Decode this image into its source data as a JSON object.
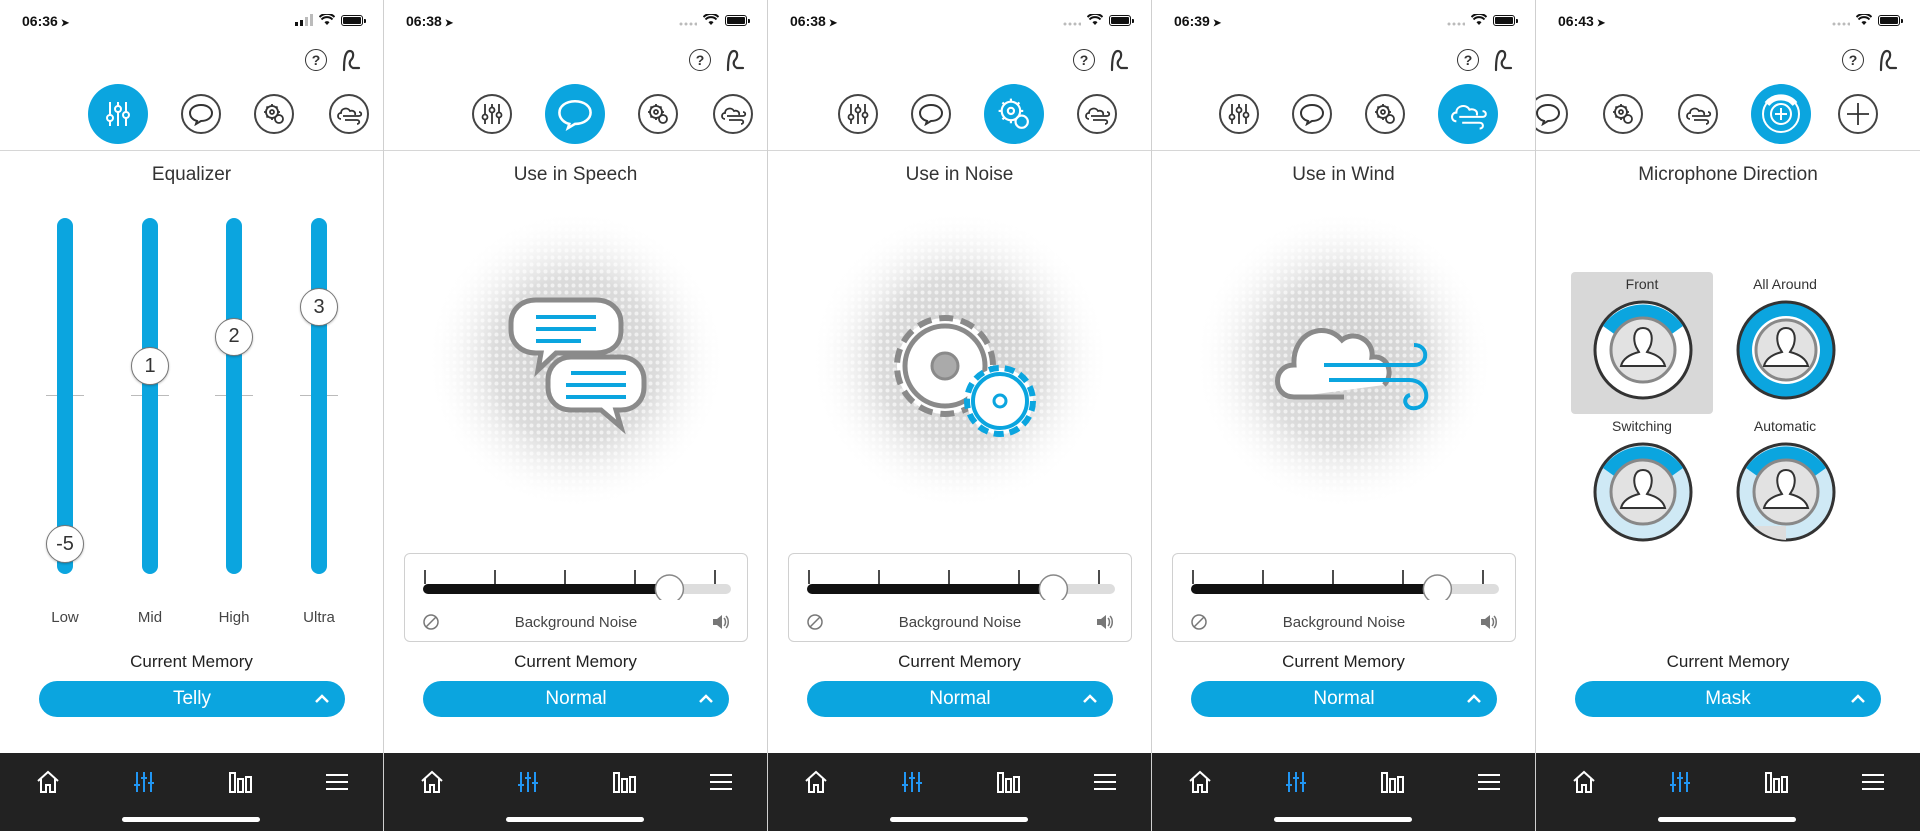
{
  "colors": {
    "accent": "#0ba5df",
    "nav_bg": "#222222",
    "text": "#333333"
  },
  "icons": {
    "location_arrow": "location-arrow-icon",
    "signal": "cellular-signal-icon",
    "wifi": "wifi-icon",
    "battery": "battery-icon",
    "help": "help-icon",
    "hearing_aid": "hearing-aid-icon",
    "nav": [
      "home-icon",
      "equalizer-icon",
      "bar-chart-icon",
      "menu-icon"
    ]
  },
  "help_glyph": "?",
  "screens": [
    {
      "status": {
        "time": "06:36"
      },
      "title": "Equalizer",
      "equalizer": {
        "bands": [
          {
            "label": "Low",
            "value": -5,
            "display": "-5"
          },
          {
            "label": "Mid",
            "value": 1,
            "display": "1"
          },
          {
            "label": "High",
            "value": 2,
            "display": "2"
          },
          {
            "label": "Ultra",
            "value": 3,
            "display": "3"
          }
        ],
        "range": [
          -6,
          6
        ]
      },
      "memory_label": "Current Memory",
      "memory_value": "Telly",
      "active_tab": "equalizer"
    },
    {
      "status": {
        "time": "06:38"
      },
      "title": "Use in Speech",
      "slider": {
        "label": "Background Noise",
        "value": 0.8
      },
      "memory_label": "Current Memory",
      "memory_value": "Normal",
      "active_tab": "speech"
    },
    {
      "status": {
        "time": "06:38"
      },
      "title": "Use in Noise",
      "slider": {
        "label": "Background Noise",
        "value": 0.8
      },
      "memory_label": "Current Memory",
      "memory_value": "Normal",
      "active_tab": "noise"
    },
    {
      "status": {
        "time": "06:39"
      },
      "title": "Use in Wind",
      "slider": {
        "label": "Background Noise",
        "value": 0.8
      },
      "memory_label": "Current Memory",
      "memory_value": "Normal",
      "active_tab": "wind"
    },
    {
      "status": {
        "time": "06:43"
      },
      "title": "Microphone Direction",
      "directions": [
        "Front",
        "All Around",
        "Switching",
        "Automatic"
      ],
      "selected_direction": "Front",
      "memory_label": "Current Memory",
      "memory_value": "Mask",
      "active_tab": "mic-direction"
    }
  ]
}
